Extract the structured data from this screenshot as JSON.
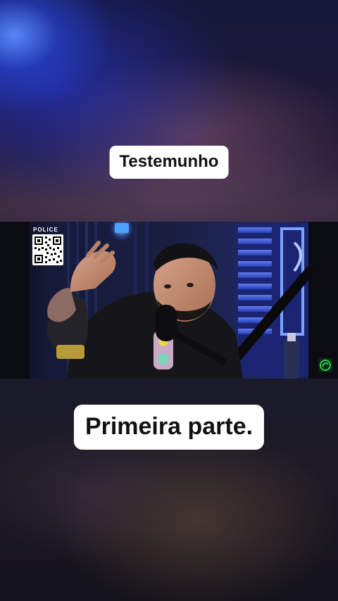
{
  "captions": {
    "top": "Testemunho",
    "bottom": "Primeira parte."
  },
  "video": {
    "overlay_label": "POLICE",
    "qr_icon": "qr-code-icon",
    "corner_icon": "channel-logo-icon"
  },
  "colors": {
    "caption_bg": "#ffffff",
    "caption_text": "#111111",
    "neon_blue": "#3a7cff",
    "logo_green": "#2ecc50"
  }
}
